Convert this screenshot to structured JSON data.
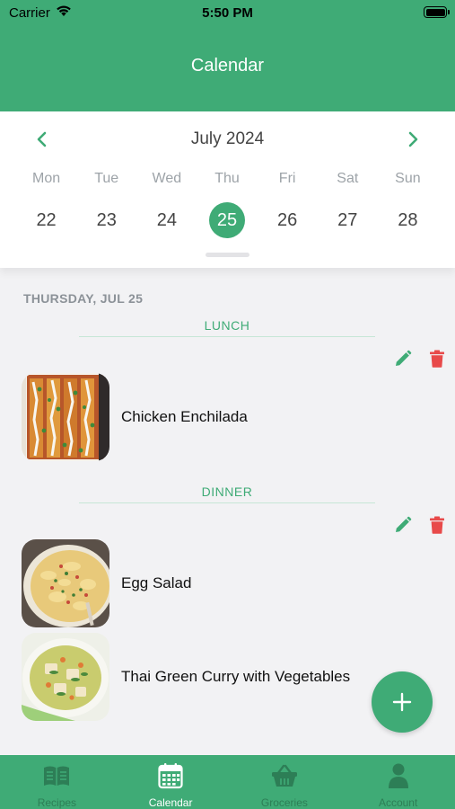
{
  "status_bar": {
    "carrier": "Carrier",
    "time": "5:50 PM"
  },
  "header": {
    "title": "Calendar"
  },
  "calendar": {
    "month": "July 2024",
    "weekdays": [
      "Mon",
      "Tue",
      "Wed",
      "Thu",
      "Fri",
      "Sat",
      "Sun"
    ],
    "days": [
      "22",
      "23",
      "24",
      "25",
      "26",
      "27",
      "28"
    ],
    "selected_day": "25"
  },
  "date_header": "THURSDAY, JUL 25",
  "meals": [
    {
      "section": "LUNCH",
      "recipes": [
        {
          "name": "Chicken Enchilada"
        }
      ]
    },
    {
      "section": "DINNER",
      "recipes": [
        {
          "name": "Egg Salad"
        },
        {
          "name": "Thai Green Curry with Vegetables"
        }
      ]
    }
  ],
  "colors": {
    "primary": "#3fab76",
    "delete": "#e84a4a",
    "tab_inactive": "#2d7e56"
  },
  "tabs": [
    {
      "label": "Recipes",
      "icon": "recipe-book-icon",
      "active": false
    },
    {
      "label": "Calendar",
      "icon": "calendar-icon",
      "active": true
    },
    {
      "label": "Groceries",
      "icon": "basket-icon",
      "active": false
    },
    {
      "label": "Account",
      "icon": "person-icon",
      "active": false
    }
  ]
}
